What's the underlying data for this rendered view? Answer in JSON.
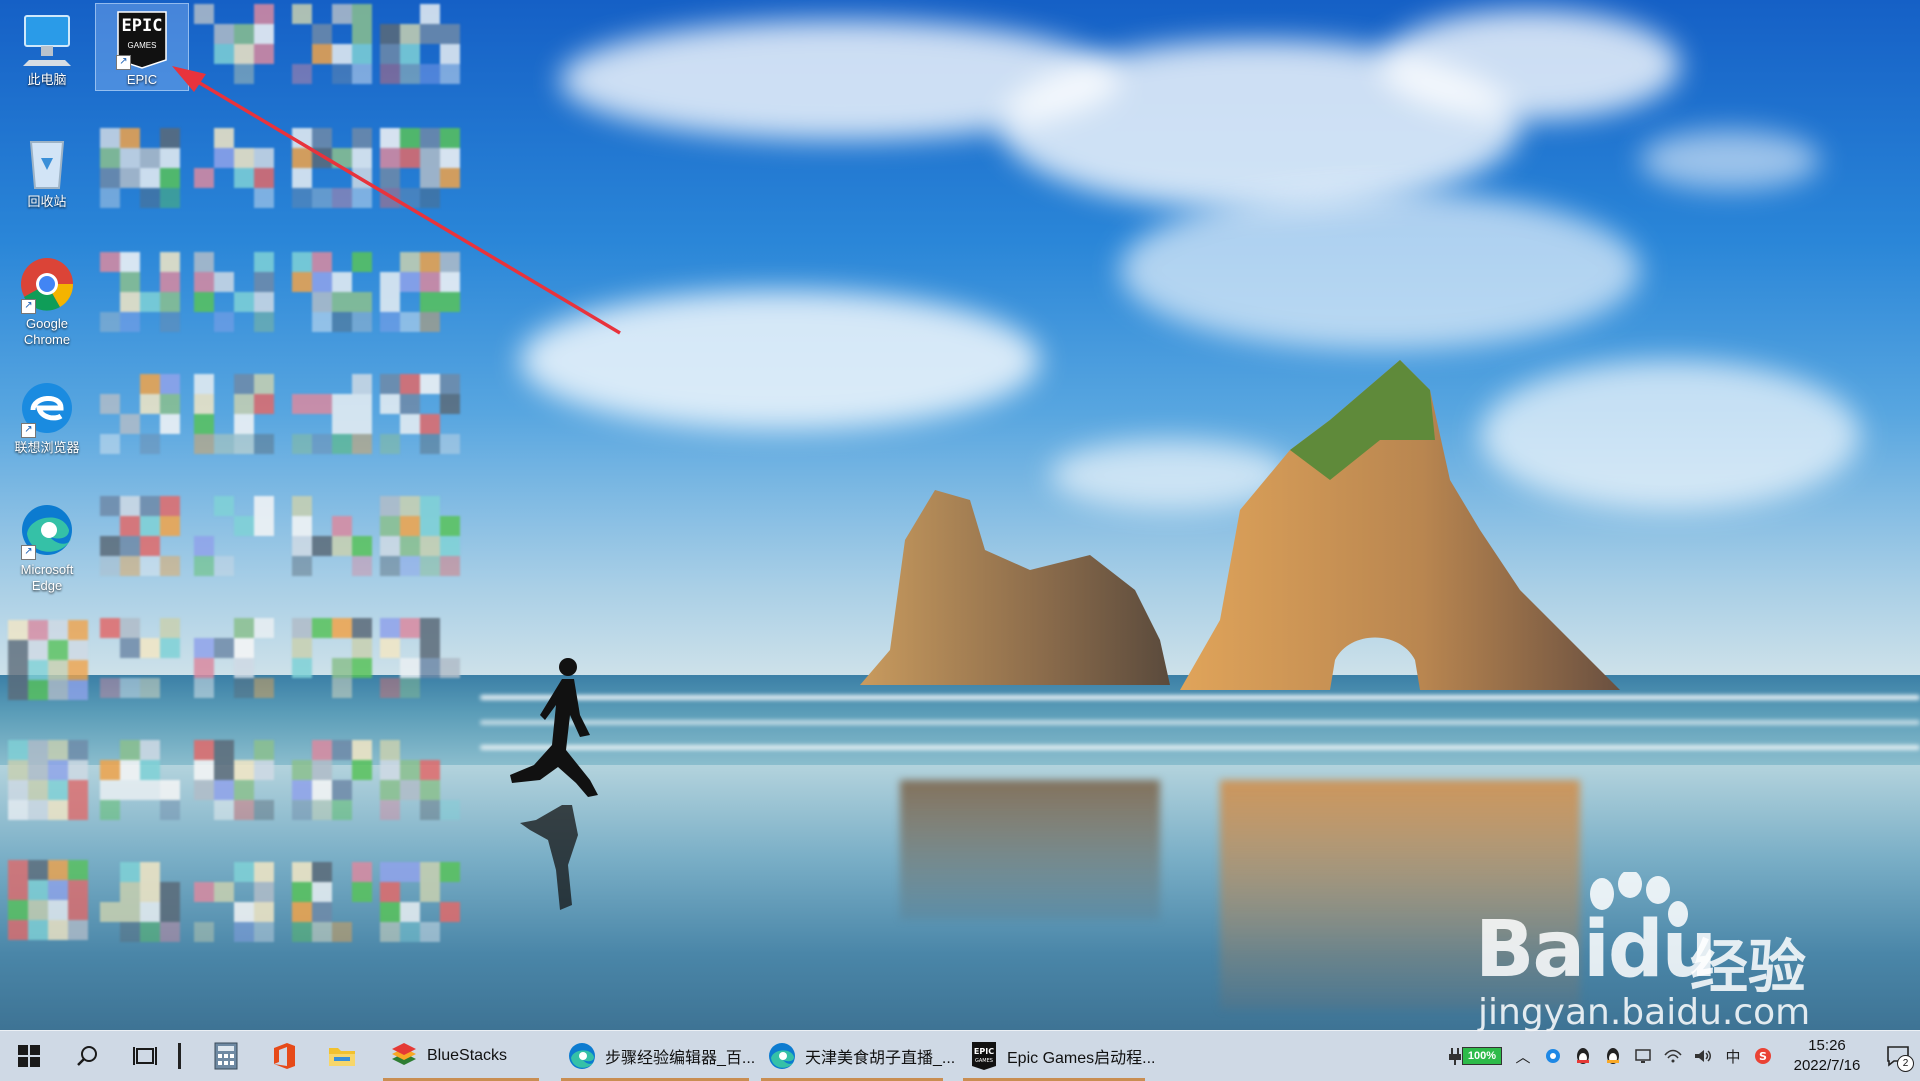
{
  "desktop": {
    "icons": [
      {
        "label": "此电脑",
        "icon": "this-pc-icon"
      },
      {
        "label": "EPIC",
        "icon": "epic-games-icon",
        "selected": true
      },
      {
        "label": "回收站",
        "icon": "recycle-bin-icon"
      },
      {
        "label": "Google Chrome",
        "icon": "chrome-icon"
      },
      {
        "label": "联想浏览器",
        "icon": "lenovo-browser-icon"
      },
      {
        "label": "Microsoft Edge",
        "icon": "edge-icon"
      }
    ],
    "epic_logo_line1": "EPIC",
    "epic_logo_line2": "GAMES"
  },
  "watermark": {
    "brand": "Bai",
    "brand_suffix": "du",
    "cn_text": "经验",
    "url": "jingyan.baidu.com"
  },
  "taskbar": {
    "start_icon": "windows-start-icon",
    "search_icon": "search-icon",
    "taskview_icon": "task-view-icon",
    "apps": [
      {
        "label": "BlueStacks",
        "icon": "bluestacks-icon"
      },
      {
        "label": "步骤经验编辑器_百...",
        "icon": "edge-icon"
      },
      {
        "label": "天津美食胡子直播_...",
        "icon": "edge-icon"
      },
      {
        "label": "Epic Games启动程...",
        "icon": "epic-games-icon"
      }
    ],
    "battery_percent": "100%",
    "ime_label": "中",
    "time": "15:26",
    "date": "2022/7/16",
    "notification_count": "2",
    "colors": {
      "running_indicator": "#c98e52",
      "taskbar_bg": "#dee2e8"
    }
  }
}
